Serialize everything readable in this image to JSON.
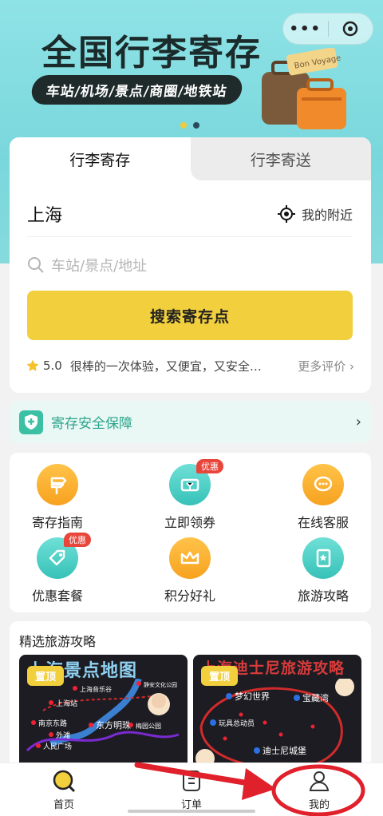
{
  "banner": {
    "title": "全国行李寄存",
    "subtitle": "车站/机场/景点/商圈/地铁站",
    "luggage_tag": "Bon Voyage",
    "capsule": {
      "more": "•••"
    }
  },
  "search_card": {
    "tabs": [
      {
        "label": "行李寄存"
      },
      {
        "label": "行李寄送"
      }
    ],
    "city": "上海",
    "nearby_label": "我的附近",
    "search_placeholder": "车站/景点/地址",
    "search_button": "搜索寄存点",
    "review": {
      "score": "5.0",
      "text": "很棒的一次体验，又便宜，又安全…",
      "more": "更多评价"
    }
  },
  "safety": {
    "label": "寄存安全保障"
  },
  "grid": {
    "items": [
      {
        "label": "寄存指南",
        "icon": "signpost-icon"
      },
      {
        "label": "立即领券",
        "icon": "coupon-icon",
        "badge": "优惠"
      },
      {
        "label": "在线客服",
        "icon": "chat-icon"
      },
      {
        "label": "优惠套餐",
        "icon": "tag-icon",
        "badge": "优惠"
      },
      {
        "label": "积分好礼",
        "icon": "crown-icon"
      },
      {
        "label": "旅游攻略",
        "icon": "guidebook-icon"
      }
    ]
  },
  "guides": {
    "title": "精选旅游攻略",
    "cards": [
      {
        "tag": "置顶",
        "title": "上海景点地图",
        "labels": [
          "上海站",
          "上海音乐谷",
          "静安文化公园",
          "东方明珠",
          "梅园公园",
          "南京东路",
          "外滩",
          "人民广场"
        ]
      },
      {
        "tag": "置顶",
        "title": "上海迪士尼旅游攻略",
        "labels": [
          "梦幻世界",
          "宝藏湾",
          "迪士尼城堡",
          "玩具总动员"
        ]
      }
    ]
  },
  "bottom_nav": {
    "items": [
      {
        "label": "首页",
        "icon": "home-search-icon"
      },
      {
        "label": "订单",
        "icon": "order-icon"
      },
      {
        "label": "我的",
        "icon": "user-icon"
      }
    ]
  },
  "colors": {
    "accent": "#f1cf3d",
    "teal": "#2aa48b",
    "annotation": "#e0202b"
  }
}
